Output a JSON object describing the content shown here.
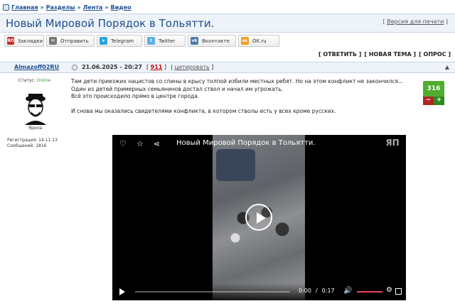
{
  "breadcrumbs": [
    "Главная",
    "Разделы",
    "Лента",
    "Видео"
  ],
  "breadcrumb_sep": "»",
  "topic_title": "Новый Мировой Порядок в Тольятти.",
  "print_link": {
    "prefix": "[",
    "label": "Версия для печати",
    "suffix": "]"
  },
  "share_buttons": [
    {
      "label": "Закладки",
      "icon": "yap-icon",
      "color": "#c62828",
      "glyph": "ЯП"
    },
    {
      "label": "Отправить",
      "icon": "mail-icon",
      "color": "#777777",
      "glyph": "✉"
    },
    {
      "label": "Telegram",
      "icon": "telegram-icon",
      "color": "#2aa3df",
      "glyph": "➤"
    },
    {
      "label": "Twitter",
      "icon": "twitter-icon",
      "color": "#5aaee6",
      "glyph": "t"
    },
    {
      "label": "Вконтакте",
      "icon": "vk-icon",
      "color": "#4a76a8",
      "glyph": "vk"
    },
    {
      "label": "OK.ru",
      "icon": "ok-icon",
      "color": "#f59b1e",
      "glyph": "ok"
    }
  ],
  "actions": [
    "[ ОТВЕТИТЬ ]",
    "[ НОВАЯ ТЕМА ]",
    "[ ОПРОС ]"
  ],
  "post": {
    "author": "Almazoff02RU",
    "date": "21.06.2025 - 20:27",
    "number": "911",
    "quote": "цитировать",
    "status_label": "Статус:",
    "status_value": "Online",
    "nick": "Ярила",
    "registration": "Регистрация: 14.11.13",
    "messages": "Сообщений: 1816",
    "text": [
      "Там дети приезжих нацистов со спины в крысу толпой избили местных ребят. Но на этом конфликт не закончился... Один из детей примерных семьянинов достал ствол и начал им угрожать.",
      "Всё это происходило прямо в центре города.",
      "И снова мы оказались свидетелями конфликта, в котором стволы есть у всех кроме русских."
    ],
    "rating": "316"
  },
  "video": {
    "title": "Новый Мировой Порядок в Тольятти.",
    "logo": "ЯП",
    "current_time": "0:00",
    "time_sep": "/",
    "duration": "0:17"
  }
}
